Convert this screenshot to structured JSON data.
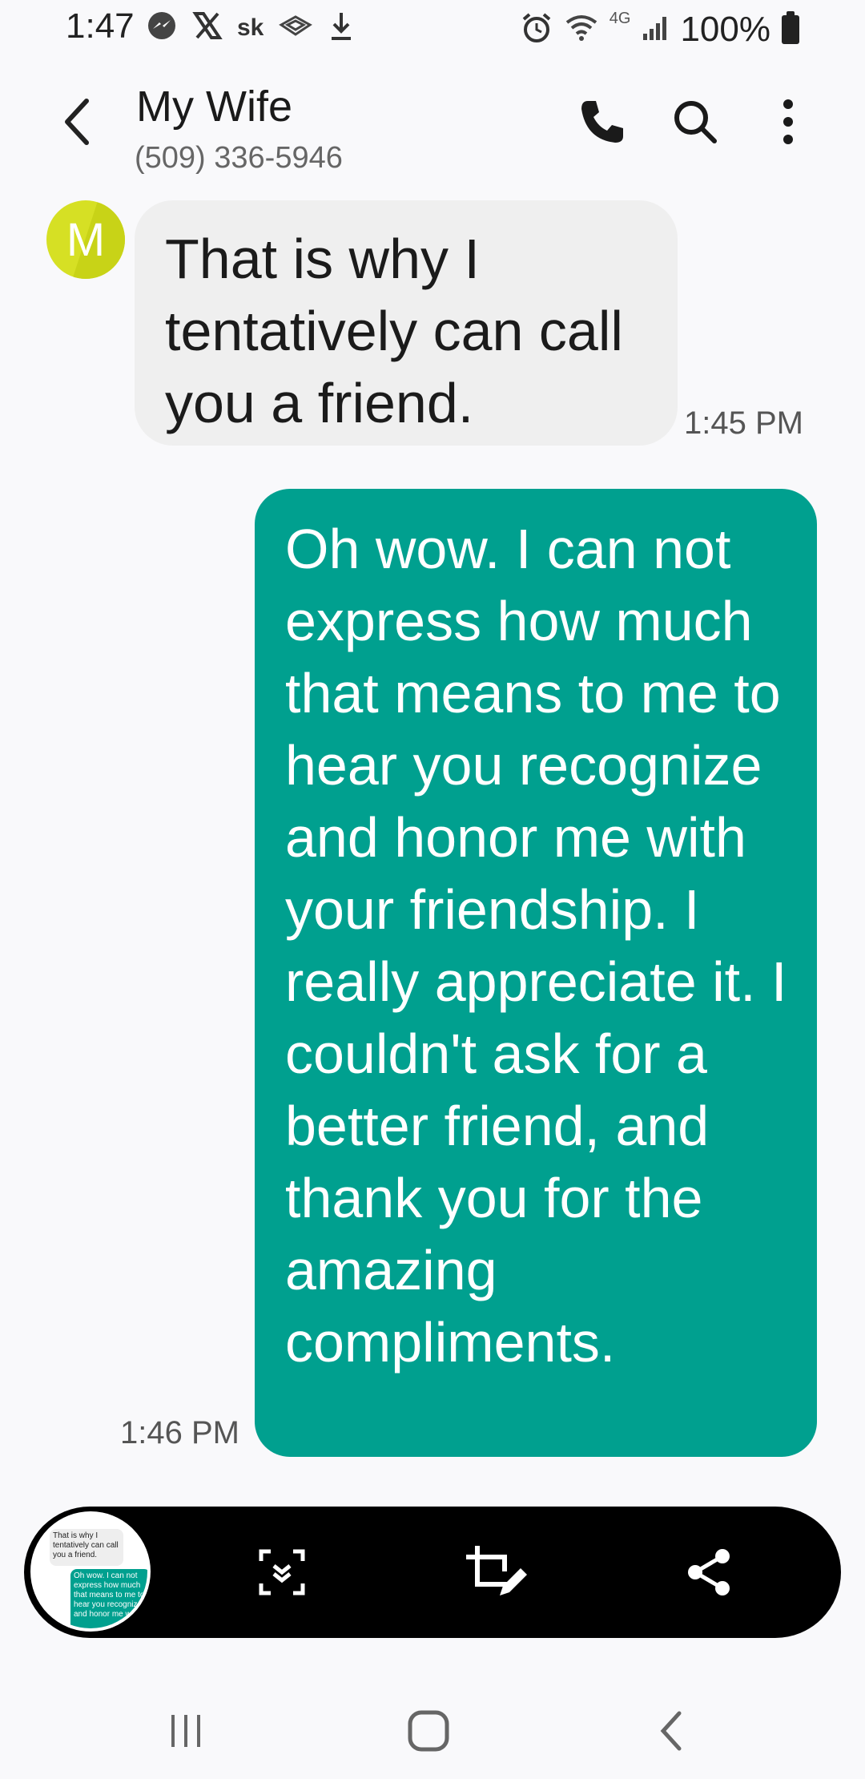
{
  "status_bar": {
    "time": "1:47",
    "left_icons": [
      "messenger-icon",
      "x-icon",
      "sk-icon",
      "cast-icon",
      "download-icon"
    ],
    "sk_label": "sk",
    "right_icons": [
      "alarm-icon",
      "wifi-icon",
      "4g-icon",
      "signal-icon"
    ],
    "network": "4G",
    "battery": "100%"
  },
  "header": {
    "contact_name": "My Wife",
    "contact_number": "(509) 336-5946",
    "icons": [
      "back-icon",
      "phone-icon",
      "search-icon",
      "more-options-icon"
    ]
  },
  "conversation": {
    "avatar_letter": "M",
    "messages": [
      {
        "direction": "incoming",
        "text": "That is why I tentatively can call you a friend.",
        "time": "1:45 PM"
      },
      {
        "direction": "outgoing",
        "text": "Oh wow.  I can not express how much that means to me to hear you recognize and honor me with your friendship.  I really appreciate it.  I couldn't ask for a better friend, and thank you for the amazing compliments.",
        "time": "1:46 PM"
      }
    ]
  },
  "screenshot_toolbar": {
    "thumbnail_in": "That is why I tentatively can call you a friend.",
    "thumbnail_out": "Oh wow.  I can not express how much that means to me to hear you recognize and honor me with",
    "icons": [
      "scroll-capture-icon",
      "crop-edit-icon",
      "share-icon"
    ]
  },
  "nav_bar": {
    "icons": [
      "recent-apps-icon",
      "home-icon",
      "back-nav-icon"
    ]
  },
  "colors": {
    "outgoing_bubble": "#00a08f",
    "incoming_bubble": "#efefef",
    "avatar": "#d6e024",
    "background": "#f9f9fb"
  }
}
